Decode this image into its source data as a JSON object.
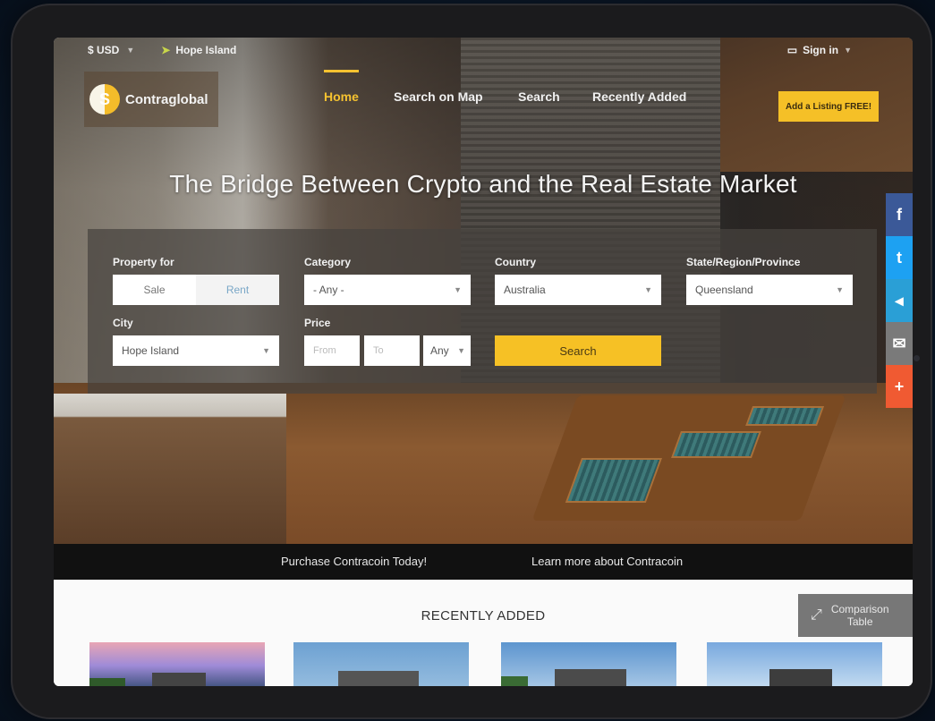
{
  "topbar": {
    "currency": "$ USD",
    "location": "Hope Island",
    "signin": "Sign in"
  },
  "brand": {
    "name": "Contraglobal"
  },
  "nav": {
    "items": [
      "Home",
      "Search on Map",
      "Search",
      "Recently Added"
    ],
    "active": "Home",
    "cta": "Add a Listing FREE!"
  },
  "hero": {
    "headline": "The Bridge Between Crypto and the Real Estate Market"
  },
  "search": {
    "property_for_label": "Property for",
    "property_for_options": [
      "Sale",
      "Rent"
    ],
    "category_label": "Category",
    "category_value": "- Any -",
    "country_label": "Country",
    "country_value": "Australia",
    "state_label": "State/Region/Province",
    "state_value": "Queensland",
    "city_label": "City",
    "city_value": "Hope Island",
    "price_label": "Price",
    "price_from_placeholder": "From",
    "price_to_placeholder": "To",
    "price_currency": "Any",
    "button": "Search"
  },
  "social": {
    "icons": [
      "facebook-icon",
      "twitter-icon",
      "telegram-icon",
      "email-icon",
      "plus-icon"
    ],
    "glyphs": [
      "f",
      "t",
      "◂",
      "✉",
      "+"
    ],
    "colors": [
      "#3b5998",
      "#1da1f2",
      "#2a9fd6",
      "#7a7a7a",
      "#f05a32"
    ]
  },
  "promo": {
    "purchase": "Purchase Contracoin Today!",
    "learn": "Learn more about Contracoin"
  },
  "recent": {
    "title": "RECENTLY ADDED",
    "compare_line1": "Comparison",
    "compare_line2": "Table"
  },
  "colors": {
    "accent": "#f5c027",
    "promo_bg": "#111111"
  }
}
